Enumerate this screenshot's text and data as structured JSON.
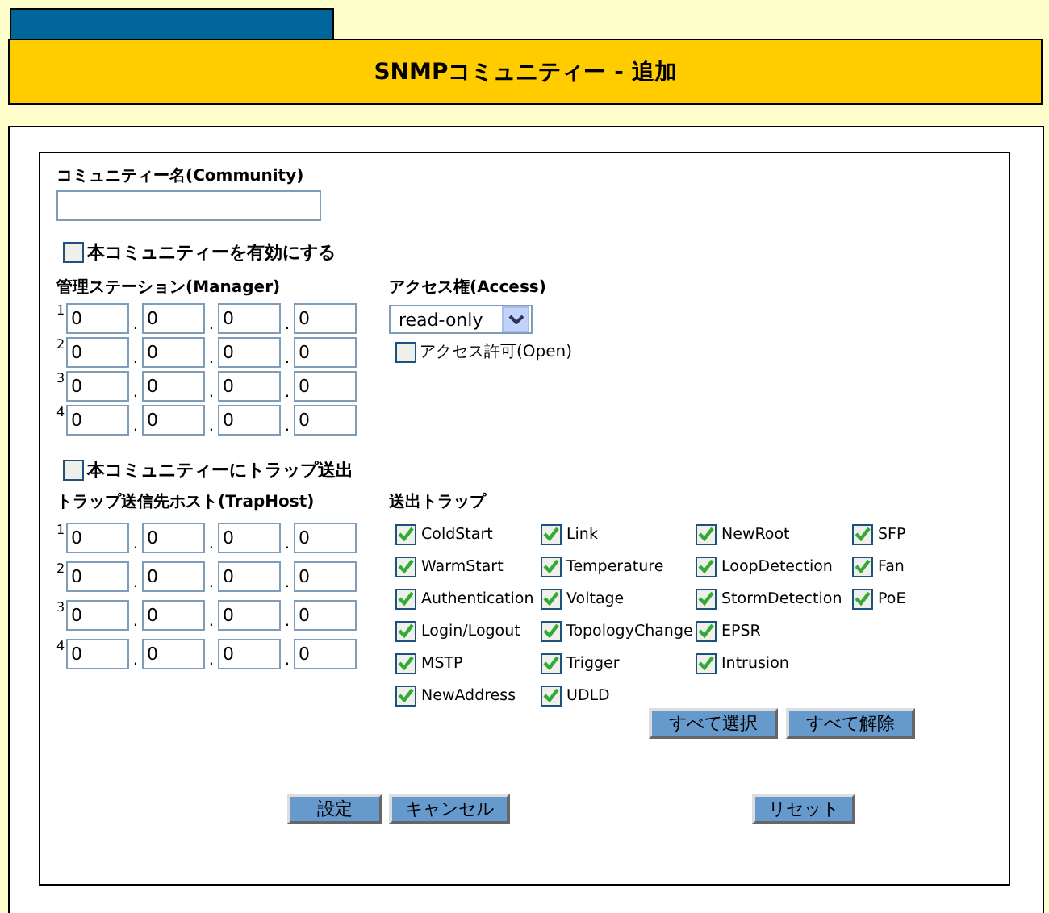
{
  "title": "SNMPコミュニティー - 追加",
  "community": {
    "label": "コミュニティー名(Community)"
  },
  "enable": {
    "label": "本コミュニティーを有効にする",
    "checked": false
  },
  "manager": {
    "label": "管理ステーション(Manager)",
    "rows": [
      {
        "index": "1",
        "octets": [
          "0",
          "0",
          "0",
          "0"
        ],
        "dots": [
          ".",
          ".",
          "."
        ]
      },
      {
        "index": "2",
        "octets": [
          "0",
          "0",
          "0",
          "0"
        ],
        "dots": [
          ".",
          ".",
          "."
        ]
      },
      {
        "index": "3",
        "octets": [
          "0",
          "0",
          "0",
          "0"
        ],
        "dots": [
          ".",
          ".",
          "."
        ]
      },
      {
        "index": "4",
        "octets": [
          "0",
          "0",
          "0",
          "0"
        ],
        "dots": [
          ".",
          ".",
          "."
        ]
      }
    ]
  },
  "access": {
    "label": "アクセス権(Access)",
    "value": "read-only",
    "open": {
      "label": "アクセス許可(Open)",
      "checked": false
    }
  },
  "trap_enable": {
    "label": "本コミュニティーにトラップ送出",
    "checked": false
  },
  "traphost": {
    "label": "トラップ送信先ホスト(TrapHost)",
    "rows": [
      {
        "index": "1",
        "octets": [
          "0",
          "0",
          "0",
          "0"
        ],
        "dots": [
          ".",
          ".",
          "."
        ]
      },
      {
        "index": "2",
        "octets": [
          "0",
          "0",
          "0",
          "0"
        ],
        "dots": [
          ".",
          ".",
          "."
        ]
      },
      {
        "index": "3",
        "octets": [
          "0",
          "0",
          "0",
          "0"
        ],
        "dots": [
          ".",
          ".",
          "."
        ]
      },
      {
        "index": "4",
        "octets": [
          "0",
          "0",
          "0",
          "0"
        ],
        "dots": [
          ".",
          ".",
          "."
        ]
      }
    ]
  },
  "traps": {
    "label": "送出トラップ",
    "columns": [
      [
        {
          "label": "ColdStart",
          "checked": true
        },
        {
          "label": "WarmStart",
          "checked": true
        },
        {
          "label": "Authentication",
          "checked": true
        },
        {
          "label": "Login/Logout",
          "checked": true
        },
        {
          "label": "MSTP",
          "checked": true
        },
        {
          "label": "NewAddress",
          "checked": true
        }
      ],
      [
        {
          "label": "Link",
          "checked": true
        },
        {
          "label": "Temperature",
          "checked": true
        },
        {
          "label": "Voltage",
          "checked": true
        },
        {
          "label": "TopologyChange",
          "checked": true
        },
        {
          "label": "Trigger",
          "checked": true
        },
        {
          "label": "UDLD",
          "checked": true
        }
      ],
      [
        {
          "label": "NewRoot",
          "checked": true
        },
        {
          "label": "LoopDetection",
          "checked": true
        },
        {
          "label": "StormDetection",
          "checked": true
        },
        {
          "label": "EPSR",
          "checked": true
        },
        {
          "label": "Intrusion",
          "checked": true
        }
      ],
      [
        {
          "label": "SFP",
          "checked": true
        },
        {
          "label": "Fan",
          "checked": true
        },
        {
          "label": "PoE",
          "checked": true
        }
      ]
    ],
    "buttons": [
      "すべて選択",
      "すべて解除"
    ]
  },
  "buttons": [
    "設定",
    "キャンセル",
    "リセット"
  ]
}
